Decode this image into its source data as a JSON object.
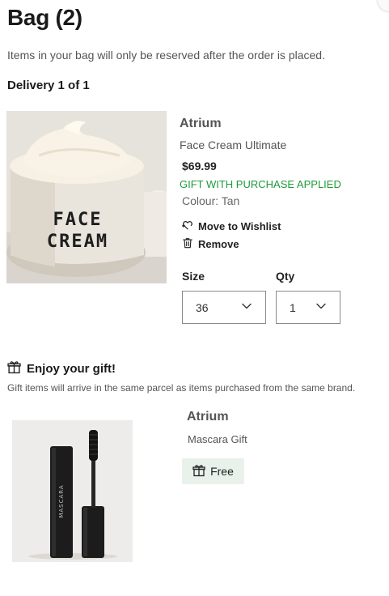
{
  "bag": {
    "title": "Bag (2)",
    "notice": "Items in your bag will only be reserved after the order is placed.",
    "delivery_label": "Delivery 1 of 1"
  },
  "product": {
    "brand": "Atrium",
    "name": "Face Cream Ultimate",
    "price": "$69.99",
    "gift_status": "GIFT WITH PURCHASE APPLIED",
    "colour": "Colour: Tan",
    "image_text": [
      "FACE",
      "CREAM"
    ],
    "actions": {
      "wishlist": "Move to Wishlist",
      "remove": "Remove"
    },
    "size": {
      "label": "Size",
      "value": "36"
    },
    "qty": {
      "label": "Qty",
      "value": "1"
    }
  },
  "gift": {
    "heading": "Enjoy your gift!",
    "note": "Gift items will arrive in the same parcel as items purchased from the same brand.",
    "brand": "Atrium",
    "name": "Mascara Gift",
    "image_text": "MASCARA",
    "badge": "Free"
  },
  "colors": {
    "gift_green": "#1e9b3b",
    "badge_bg": "#e9f2ea"
  },
  "icons": {
    "wishlist": "heart-arrow-icon",
    "remove": "trash-icon",
    "gift": "gift-icon",
    "dropdown": "chevron-down-icon"
  }
}
